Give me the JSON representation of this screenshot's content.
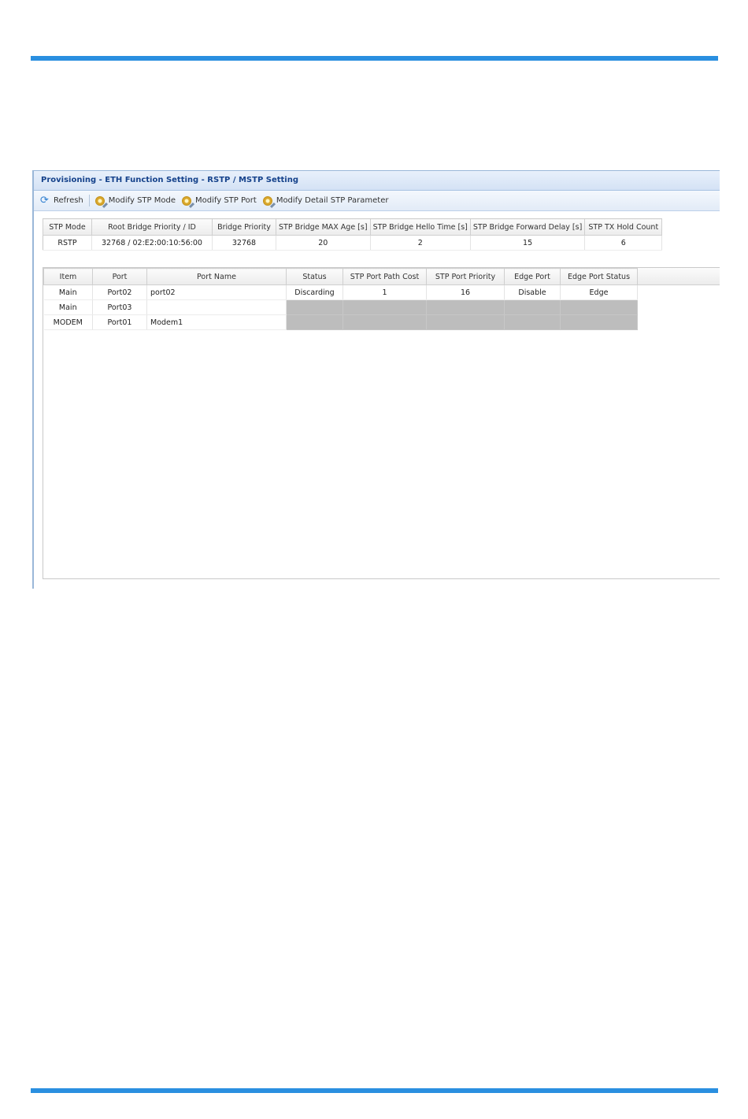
{
  "panel": {
    "title": "Provisioning - ETH Function Setting - RSTP / MSTP Setting"
  },
  "toolbar": {
    "refresh_label": "Refresh",
    "modify_mode_label": "Modify STP Mode",
    "modify_port_label": "Modify STP Port",
    "modify_detail_label": "Modify Detail STP Parameter"
  },
  "bridge_table": {
    "headers": [
      "STP Mode",
      "Root Bridge Priority / ID",
      "Bridge Priority",
      "STP Bridge MAX Age [s]",
      "STP Bridge Hello Time [s]",
      "STP Bridge Forward Delay [s]",
      "STP TX Hold Count"
    ],
    "row": [
      "RSTP",
      "32768 / 02:E2:00:10:56:00",
      "32768",
      "20",
      "2",
      "15",
      "6"
    ]
  },
  "port_table": {
    "headers": [
      "Item",
      "Port",
      "Port Name",
      "Status",
      "STP Port Path Cost",
      "STP Port Priority",
      "Edge Port",
      "Edge Port Status"
    ],
    "rows": [
      [
        "Main",
        "Port02",
        "port02",
        "Discarding",
        "1",
        "16",
        "Disable",
        "Edge"
      ],
      [
        "Main",
        "Port03",
        "",
        "",
        "",
        "",
        "",
        ""
      ],
      [
        "MODEM",
        "Port01",
        "Modem1",
        "",
        "",
        "",
        "",
        ""
      ]
    ]
  }
}
